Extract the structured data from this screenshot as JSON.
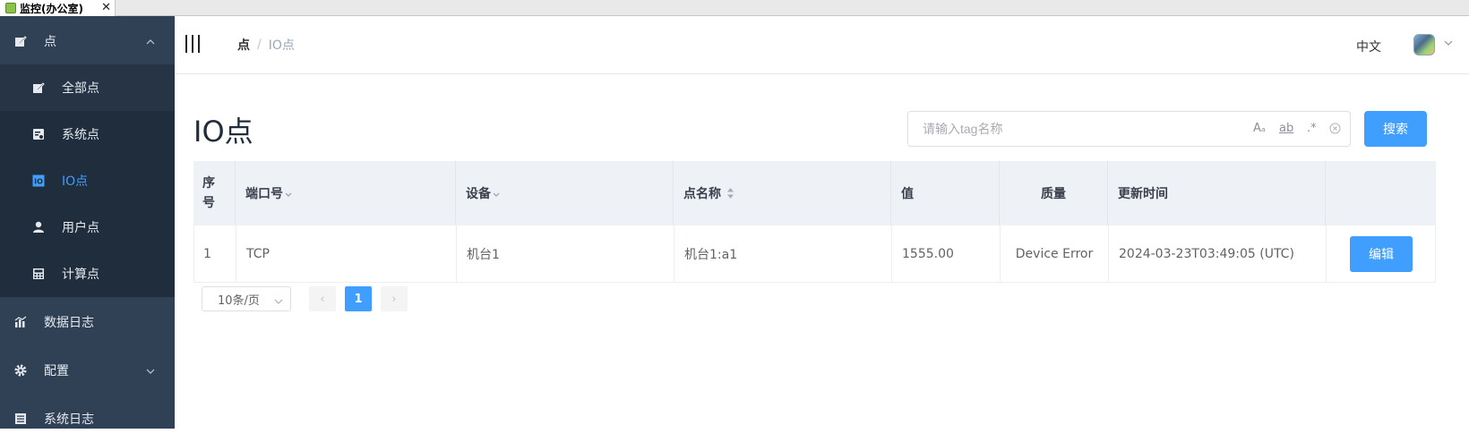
{
  "window": {
    "tab_title": "监控(办公室)",
    "close_glyph": "✕"
  },
  "sidebar": {
    "group_points": "点",
    "items": [
      {
        "label": "全部点",
        "icon": "edit-icon"
      },
      {
        "label": "系统点",
        "icon": "system-icon"
      },
      {
        "label": "IO点",
        "icon": "io-icon",
        "active": true
      },
      {
        "label": "用户点",
        "icon": "user-icon"
      },
      {
        "label": "计算点",
        "icon": "calculator-icon"
      }
    ],
    "data_log": "数据日志",
    "config": "配置",
    "system_log": "系统日志",
    "active_color": "#409eff",
    "bg_color": "#304156"
  },
  "header": {
    "breadcrumb_root": "点",
    "breadcrumb_sep": "/",
    "breadcrumb_current": "IO点",
    "language": "中文"
  },
  "main": {
    "title": "IO点",
    "search": {
      "placeholder": "请输入tag名称",
      "opt_case": "Aₐ",
      "opt_word": "ab",
      "opt_regex": ".*",
      "button": "搜索"
    }
  },
  "table": {
    "columns": [
      "序号",
      "端口号",
      "设备",
      "点名称",
      "值",
      "质量",
      "更新时间",
      ""
    ],
    "rows": [
      {
        "index": "1",
        "port": "TCP",
        "device": "机台1",
        "point_name": "机台1:a1",
        "value": "1555.00",
        "quality": "Device Error",
        "updated": "2024-03-23T03:49:05 (UTC)",
        "action": "编辑"
      }
    ]
  },
  "pagination": {
    "page_size": "10条/页",
    "prev": "‹",
    "current_page": "1",
    "next": "›"
  }
}
